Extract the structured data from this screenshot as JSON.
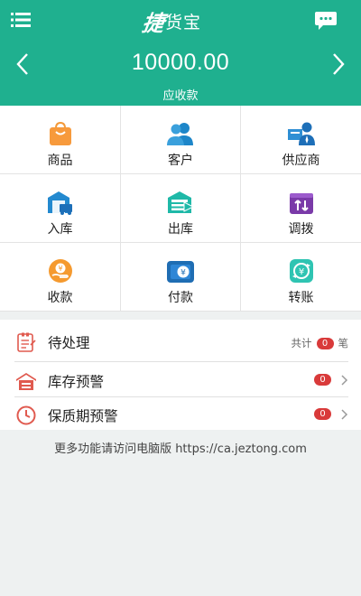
{
  "header": {
    "logo_mark": "捷",
    "logo_text": "货宝",
    "amount": "10000.00",
    "amount_label": "应收款"
  },
  "grid": [
    {
      "label": "商品",
      "icon": "shopping-bag-icon"
    },
    {
      "label": "客户",
      "icon": "customers-icon"
    },
    {
      "label": "供应商",
      "icon": "supplier-icon"
    },
    {
      "label": "入库",
      "icon": "warehouse-in-icon"
    },
    {
      "label": "出库",
      "icon": "warehouse-out-icon"
    },
    {
      "label": "调拨",
      "icon": "transfer-icon"
    },
    {
      "label": "收款",
      "icon": "receive-payment-icon"
    },
    {
      "label": "付款",
      "icon": "pay-icon"
    },
    {
      "label": "转账",
      "icon": "bank-transfer-icon"
    }
  ],
  "list": {
    "pending": {
      "label": "待处理",
      "prefix": "共计",
      "count": "0",
      "suffix": "笔"
    },
    "stock_alert": {
      "label": "库存预警",
      "count": "0"
    },
    "expiry_alert": {
      "label": "保质期预警",
      "count": "0"
    }
  },
  "footer_note": "更多功能请访问电脑版 https://ca.jeztong.com",
  "colors": {
    "header_bg": "#1fb08f",
    "badge": "#d93a3a"
  }
}
